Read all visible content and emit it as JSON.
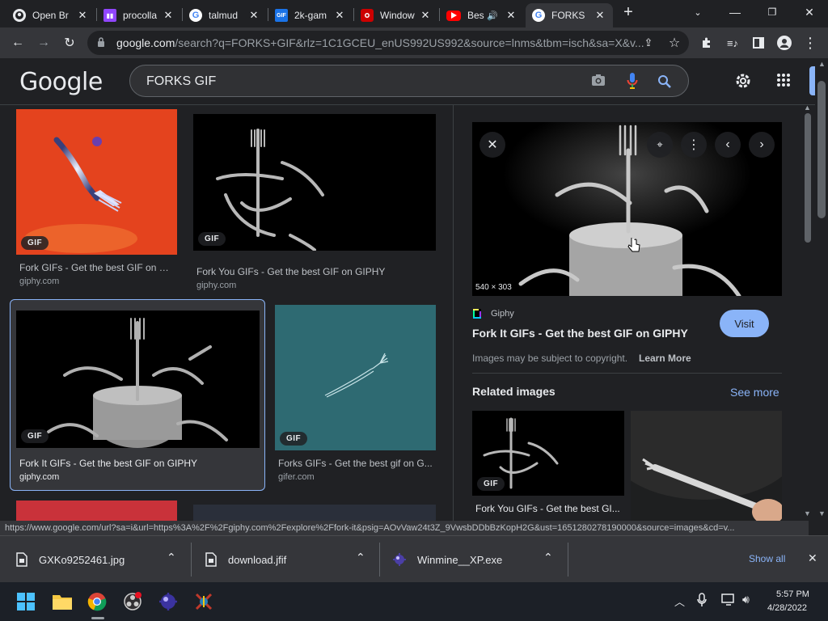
{
  "tabs": [
    {
      "title": "Open Br",
      "icon": "github-icon"
    },
    {
      "title": "procolla",
      "icon": "twitch-icon"
    },
    {
      "title": "talmud",
      "icon": "google-icon"
    },
    {
      "title": "2k-gam",
      "icon": "gif-icon"
    },
    {
      "title": "Window",
      "icon": "red-app-icon"
    },
    {
      "title": "Bes",
      "icon": "youtube-icon"
    },
    {
      "title": "FORKS",
      "icon": "google-icon"
    }
  ],
  "toolbar": {
    "url_host": "google.com",
    "url_path": "/search?q=FORKS+GIF&rlz=1C1GCEU_enUS992US992&source=lnms&tbm=isch&sa=X&v..."
  },
  "google": {
    "logo": "Google",
    "query": "FORKS GIF"
  },
  "results": [
    {
      "title": "Fork GIFs - Get the best GIF on G...",
      "source": "giphy.com",
      "badge": "GIF"
    },
    {
      "title": "Fork You GIFs - Get the best GIF on GIPHY",
      "source": "giphy.com",
      "badge": "GIF"
    },
    {
      "title": "Fork It GIFs - Get the best GIF on GIPHY",
      "source": "giphy.com",
      "badge": "GIF"
    },
    {
      "title": "Forks GIFs - Get the best gif on G...",
      "source": "gifer.com",
      "badge": "GIF"
    }
  ],
  "preview": {
    "dimensions": "540 × 303",
    "site": "Giphy",
    "title": "Fork It GIFs - Get the best GIF on GIPHY",
    "visit_label": "Visit",
    "copyright": "Images may be subject to copyright.",
    "learn_more": "Learn More",
    "related_heading": "Related images",
    "see_more": "See more",
    "related": [
      {
        "title": "Fork You GIFs - Get the best GI...",
        "badge": "GIF"
      }
    ]
  },
  "status_url": "https://www.google.com/url?sa=i&url=https%3A%2F%2Fgiphy.com%2Fexplore%2Ffork-it&psig=AOvVaw24t3Z_9VwsbDDbBzKopH2G&ust=1651280278190000&source=images&cd=v...",
  "downloads": {
    "items": [
      {
        "name": "GXKo9252461.jpg"
      },
      {
        "name": "download.jfif"
      },
      {
        "name": "Winmine__XP.exe"
      }
    ],
    "show_all": "Show all"
  },
  "taskbar": {
    "time": "5:57 PM",
    "date": "4/28/2022"
  },
  "colors": {
    "accent": "#8ab4f8",
    "background": "#202124"
  }
}
